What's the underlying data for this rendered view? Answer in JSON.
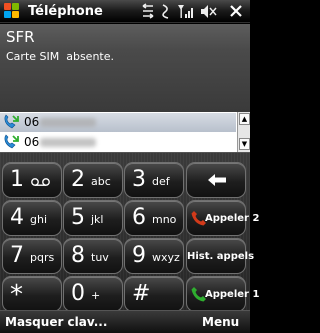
{
  "status_bar": {
    "title": "Téléphone",
    "icons": [
      "windows-logo",
      "sync-icon",
      "data-icon",
      "signal-icon",
      "volume-muted-icon",
      "close-icon"
    ]
  },
  "info": {
    "operator": "SFR",
    "sim_status": "Carte SIM  absente."
  },
  "call_list": {
    "rows": [
      {
        "number": "06",
        "icon": "call-incoming-icon",
        "selected": true
      },
      {
        "number": "06",
        "icon": "call-incoming-icon",
        "selected": false
      }
    ]
  },
  "keypad": {
    "keys": [
      {
        "digit": "1",
        "letters": ""
      },
      {
        "digit": "2",
        "letters": "abc"
      },
      {
        "digit": "3",
        "letters": "def"
      },
      {
        "digit": "4",
        "letters": "ghi"
      },
      {
        "digit": "5",
        "letters": "jkl"
      },
      {
        "digit": "6",
        "letters": "mno"
      },
      {
        "digit": "7",
        "letters": "pqrs"
      },
      {
        "digit": "8",
        "letters": "tuv"
      },
      {
        "digit": "9",
        "letters": "wxyz"
      },
      {
        "digit": "*",
        "letters": ""
      },
      {
        "digit": "0",
        "letters": "+"
      },
      {
        "digit": "#",
        "letters": ""
      }
    ],
    "backspace_icon": "backspace-arrow-icon",
    "call2_label": "Appeler 2",
    "history_label": "Hist. appels",
    "call1_label": "Appeler 1"
  },
  "softkeys": {
    "left": "Masquer clav...",
    "right": "Menu"
  },
  "colors": {
    "call_red": "#d23a1a",
    "call_green": "#2fae2f",
    "selection": "#c3c9d3"
  }
}
